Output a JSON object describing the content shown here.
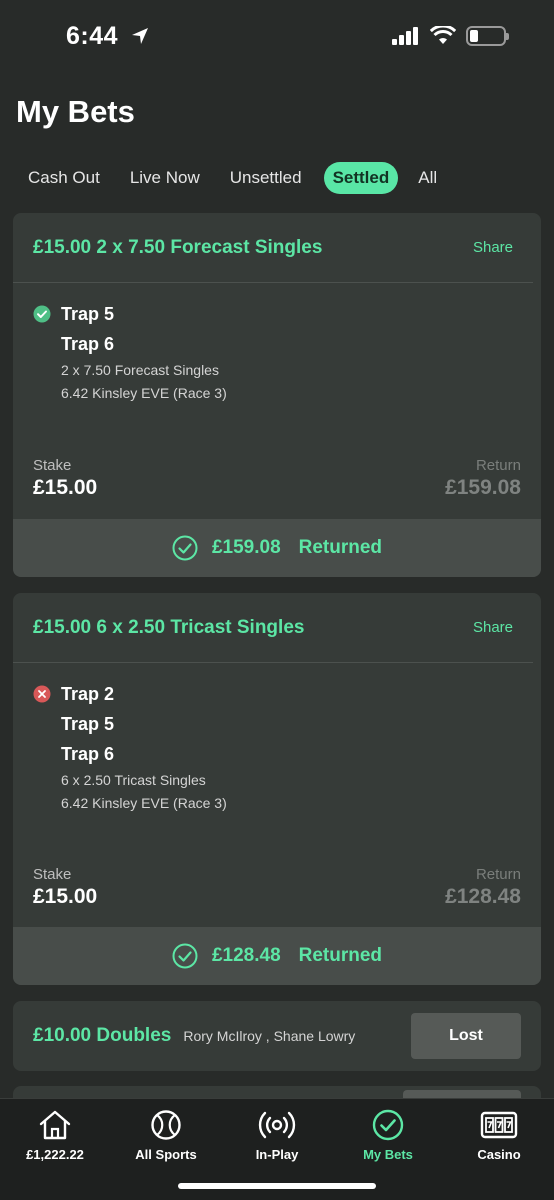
{
  "status_bar": {
    "time": "6:44"
  },
  "page_title": "My Bets",
  "tabs": [
    {
      "label": "Cash Out"
    },
    {
      "label": "Live Now"
    },
    {
      "label": "Unsettled"
    },
    {
      "label": "Settled",
      "active": true
    },
    {
      "label": "All"
    }
  ],
  "bets": [
    {
      "title": "£15.00 2 x 7.50 Forecast Singles",
      "share_label": "Share",
      "result_icon": "check-circle-icon",
      "selections": [
        "Trap 5",
        "Trap 6"
      ],
      "details": [
        "2 x 7.50 Forecast Singles",
        "6.42 Kinsley EVE (Race 3)"
      ],
      "stake_label": "Stake",
      "stake": "£15.00",
      "return_label": "Return",
      "return": "£159.08",
      "returned_amount": "£159.08",
      "returned_label": "Returned"
    },
    {
      "title": "£15.00 6 x 2.50 Tricast Singles",
      "share_label": "Share",
      "result_icon": "x-circle-icon",
      "selections": [
        "Trap 2",
        "Trap 5",
        "Trap 6"
      ],
      "details": [
        "6 x 2.50 Tricast Singles",
        "6.42 Kinsley EVE (Race 3)"
      ],
      "stake_label": "Stake",
      "stake": "£15.00",
      "return_label": "Return",
      "return": "£128.48",
      "returned_amount": "£128.48",
      "returned_label": "Returned"
    }
  ],
  "doubles_bet": {
    "title": "£10.00 Doubles",
    "subtitle": "Rory McIlroy , Shane Lowry",
    "status": "Lost"
  },
  "bottom_nav": [
    {
      "label": "£1,222.22",
      "icon": "home-icon"
    },
    {
      "label": "All Sports",
      "icon": "ball-icon"
    },
    {
      "label": "In-Play",
      "icon": "broadcast-icon"
    },
    {
      "label": "My Bets",
      "icon": "check-circle-icon",
      "active": true
    },
    {
      "label": "Casino",
      "icon": "slot-machine-icon"
    }
  ],
  "colors": {
    "accent": "#5ce6a5",
    "background": "#282b29",
    "card": "#363b38",
    "loss": "#e05c5c"
  }
}
